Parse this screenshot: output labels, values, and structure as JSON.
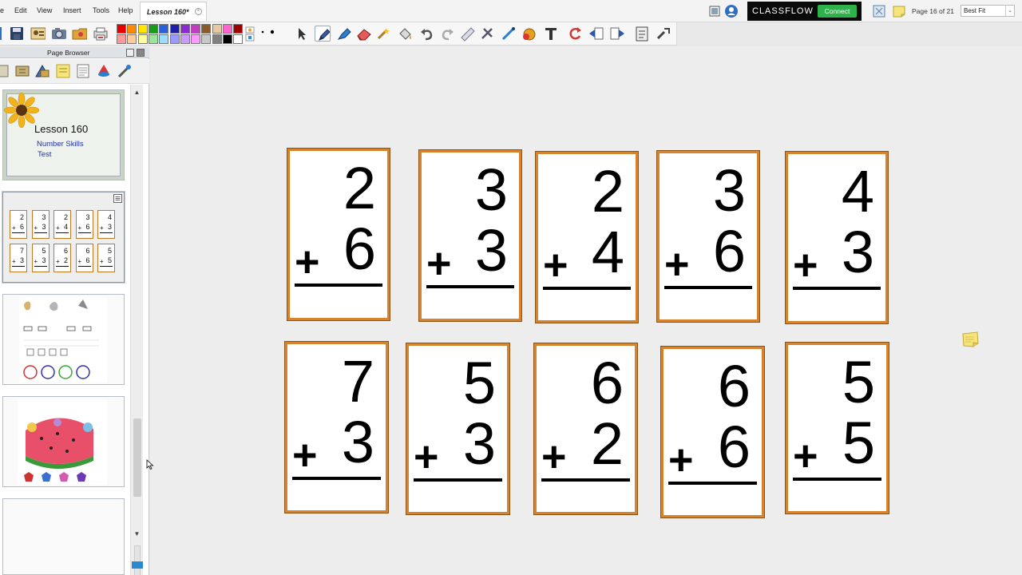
{
  "menubar": {
    "items": [
      "e",
      "Edit",
      "View",
      "Insert",
      "Tools",
      "Help"
    ],
    "tab_label": "Lesson 160*",
    "tab_close": "×"
  },
  "classflow": {
    "brand": "CLASSFLOW",
    "connect_label": "Connect"
  },
  "page_info": "Page 16 of 21",
  "zoom": {
    "selected": "Best Fit",
    "arrow": "⌄"
  },
  "toolbar": {
    "colors": [
      "#e60000",
      "#ff8a00",
      "#ffe600",
      "#1a9c1a",
      "#2c5fd8",
      "#1f1fa8",
      "#8a2bd0",
      "#c13ec1",
      "#8b5a2b",
      "#e6c9a0",
      "#ff66cc",
      "#a00000",
      "#ff9a9a",
      "#ffcc99",
      "#ffff99",
      "#99e699",
      "#99ddff",
      "#9999ff",
      "#cc99ff",
      "#ff99ff",
      "#c8c8c8",
      "#808080",
      "#000000",
      "#ffffff"
    ],
    "tools": [
      "select-icon",
      "pen-icon",
      "highlighter-icon",
      "eraser-icon",
      "magic-ink-icon",
      "fill-icon",
      "undo-icon",
      "redo-icon",
      "ruler-icon",
      "shape-icon",
      "connector-icon",
      "color-fill-icon",
      "text-icon",
      "reset-icon",
      "prev-page-icon",
      "next-page-icon",
      "notes-icon",
      "settings-icon"
    ]
  },
  "page_browser": {
    "title": "Page Browser",
    "tools": [
      "page-order-icon",
      "add-page-icon",
      "library-icon",
      "notes-icon",
      "template-icon",
      "spinner-icon",
      "tools-icon"
    ],
    "thumb1": {
      "title": "Lesson 160",
      "subtitle1": "Number Skills",
      "subtitle2": "Test"
    },
    "thumb2_cards": [
      {
        "top": "2",
        "bottom": "6"
      },
      {
        "top": "3",
        "bottom": "3"
      },
      {
        "top": "2",
        "bottom": "4"
      },
      {
        "top": "3",
        "bottom": "6"
      },
      {
        "top": "4",
        "bottom": "3"
      },
      {
        "top": "7",
        "bottom": "3"
      },
      {
        "top": "5",
        "bottom": "3"
      },
      {
        "top": "6",
        "bottom": "2"
      },
      {
        "top": "6",
        "bottom": "6"
      },
      {
        "top": "5",
        "bottom": "5"
      }
    ],
    "scroll_up": "▲",
    "scroll_down": "▼"
  },
  "cards": [
    {
      "top": "2",
      "bottom": "6",
      "plus": "+"
    },
    {
      "top": "3",
      "bottom": "3",
      "plus": "+"
    },
    {
      "top": "2",
      "bottom": "4",
      "plus": "+"
    },
    {
      "top": "3",
      "bottom": "6",
      "plus": "+"
    },
    {
      "top": "4",
      "bottom": "3",
      "plus": "+"
    },
    {
      "top": "7",
      "bottom": "3",
      "plus": "+"
    },
    {
      "top": "5",
      "bottom": "3",
      "plus": "+"
    },
    {
      "top": "6",
      "bottom": "2",
      "plus": "+"
    },
    {
      "top": "6",
      "bottom": "6",
      "plus": "+"
    },
    {
      "top": "5",
      "bottom": "5",
      "plus": "+"
    }
  ],
  "colors": {
    "card_border": "#d7822c",
    "canvas": "#ededed",
    "accent": "#2db34a"
  }
}
